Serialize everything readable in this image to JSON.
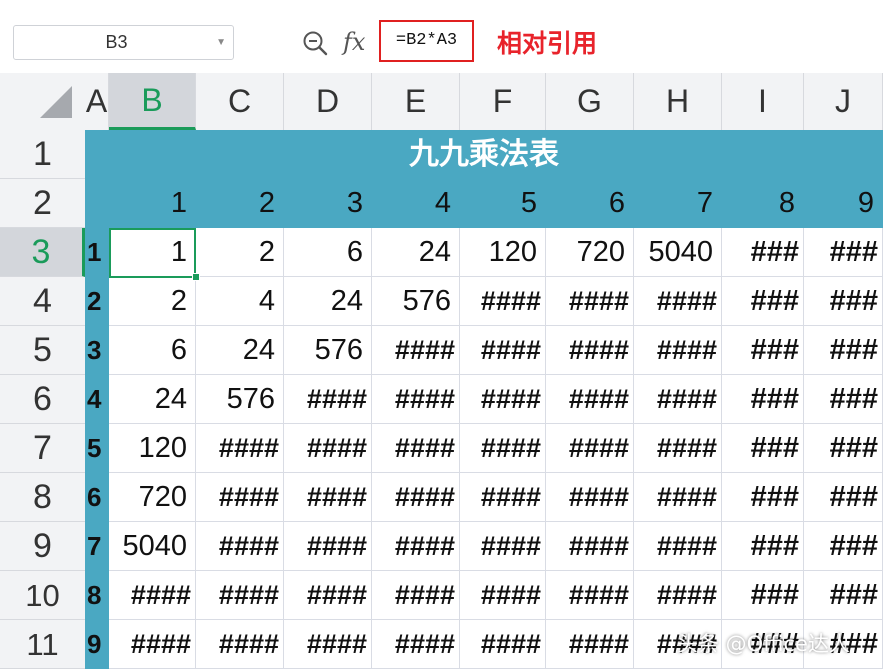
{
  "name_box": {
    "value": "B3"
  },
  "formula_bar": {
    "fx_label": "fx",
    "formula": "=B2*A3",
    "annotation": "相对引用"
  },
  "columns": [
    "A",
    "B",
    "C",
    "D",
    "E",
    "F",
    "G",
    "H",
    "I",
    "J"
  ],
  "selected_column": "B",
  "rows": [
    "1",
    "2",
    "3",
    "4",
    "5",
    "6",
    "7",
    "8",
    "9",
    "10",
    "11"
  ],
  "selected_row": "3",
  "title": "九九乘法表",
  "header_row": [
    "",
    "1",
    "2",
    "3",
    "4",
    "5",
    "6",
    "7",
    "8",
    "9"
  ],
  "table_rows": [
    [
      "1",
      "1",
      "2",
      "6",
      "24",
      "120",
      "720",
      "5040",
      "###",
      "###"
    ],
    [
      "2",
      "2",
      "4",
      "24",
      "576",
      "####",
      "####",
      "####",
      "###",
      "###"
    ],
    [
      "3",
      "6",
      "24",
      "576",
      "####",
      "####",
      "####",
      "####",
      "###",
      "###"
    ],
    [
      "4",
      "24",
      "576",
      "####",
      "####",
      "####",
      "####",
      "####",
      "###",
      "###"
    ],
    [
      "5",
      "120",
      "####",
      "####",
      "####",
      "####",
      "####",
      "####",
      "###",
      "###"
    ],
    [
      "6",
      "720",
      "####",
      "####",
      "####",
      "####",
      "####",
      "####",
      "###",
      "###"
    ],
    [
      "7",
      "5040",
      "####",
      "####",
      "####",
      "####",
      "####",
      "####",
      "###",
      "###"
    ],
    [
      "8",
      "####",
      "####",
      "####",
      "####",
      "####",
      "####",
      "####",
      "###",
      "###"
    ],
    [
      "9",
      "####",
      "####",
      "####",
      "####",
      "####",
      "####",
      "####",
      "###",
      "###"
    ]
  ],
  "active_cell": "B3",
  "colors": {
    "header_fill": "#4aa8c2",
    "selection": "#1a9b5a",
    "annotation": "#e8232b"
  },
  "icons": {
    "zoom": "zoom-formula-icon",
    "select_all": "select-all-icon",
    "dropdown": "chevron-down-icon"
  },
  "watermark": "头条 @Office达人"
}
